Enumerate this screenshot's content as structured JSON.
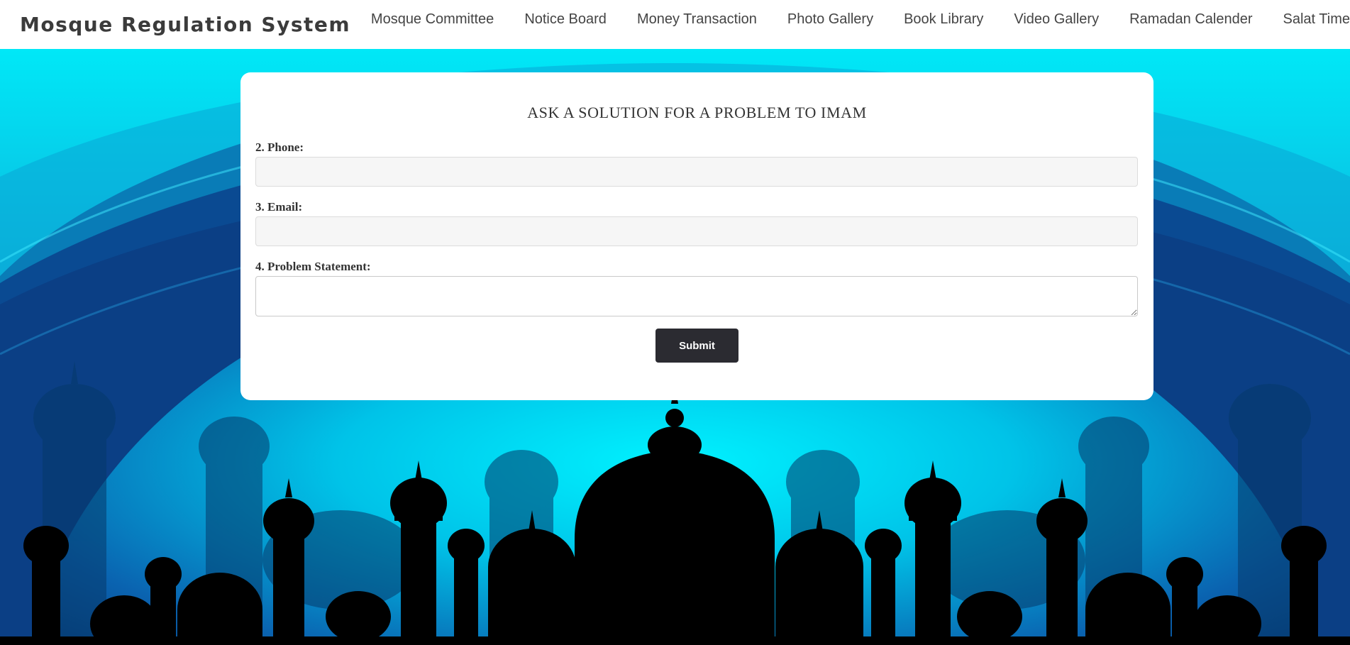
{
  "header": {
    "brand": "Mosque Regulation System",
    "nav": [
      {
        "label": "Mosque Committee"
      },
      {
        "label": "Notice Board"
      },
      {
        "label": "Money Transaction"
      },
      {
        "label": "Photo Gallery"
      },
      {
        "label": "Book Library"
      },
      {
        "label": "Video Gallery"
      },
      {
        "label": "Ramadan Calender"
      },
      {
        "label": "Salat Time"
      }
    ]
  },
  "form": {
    "title": "ASK A SOLUTION FOR A PROBLEM TO IMAM",
    "phone": {
      "label": "2. Phone:",
      "value": ""
    },
    "email": {
      "label": "3. Email:",
      "value": ""
    },
    "problem": {
      "label": "4. Problem Statement:",
      "value": ""
    },
    "submit_label": "Submit"
  },
  "theme": {
    "header_bg": "#ffffff",
    "sky_top": "#00e5f5",
    "sky_deep": "#0a3f86",
    "silhouette": "#000000",
    "button_bg": "#2b2b31"
  }
}
